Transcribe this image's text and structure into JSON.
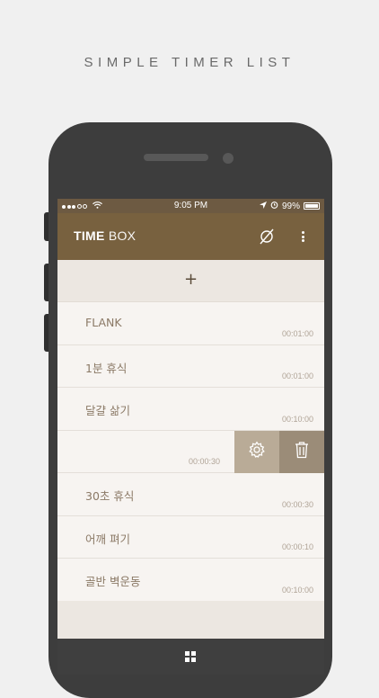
{
  "caption": "SIMPLE TIMER LIST",
  "status_bar": {
    "time": "9:05 PM",
    "battery": "99%",
    "icons": [
      "signal-dots-icon",
      "wifi-icon",
      "location-icon",
      "alarm-icon",
      "battery-icon"
    ]
  },
  "app_bar": {
    "title_bold": "TIME",
    "title_light": "BOX",
    "icons": [
      "no-alarm-icon",
      "overflow-menu-icon"
    ]
  },
  "add_row": {
    "label": "+"
  },
  "timers": [
    {
      "name": "FLANK",
      "time": "00:01:00"
    },
    {
      "name": "1분 휴식",
      "time": "00:01:00"
    },
    {
      "name": "달걀 삶기",
      "time": "00:10:00"
    },
    {
      "name": "",
      "time": "00:00:30",
      "swiped": true
    },
    {
      "name": "30초 휴식",
      "time": "00:00:30"
    },
    {
      "name": "어깨 펴기",
      "time": "00:00:10"
    },
    {
      "name": "골반 벽운동",
      "time": "00:10:00"
    }
  ],
  "swipe_actions": {
    "icons": [
      "gear-icon",
      "trash-icon"
    ]
  },
  "bottom_bar": {
    "icons": [
      "grid-icon"
    ]
  },
  "colors": {
    "app_bar": "#78613f",
    "status_bar": "#6d5a42",
    "list_bg": "#f7f4f1",
    "settings_action": "#b9ab97",
    "delete_action": "#9b8c78",
    "bottom_bar": "#3f3f3f",
    "phone_body": "#3d3d3d"
  }
}
